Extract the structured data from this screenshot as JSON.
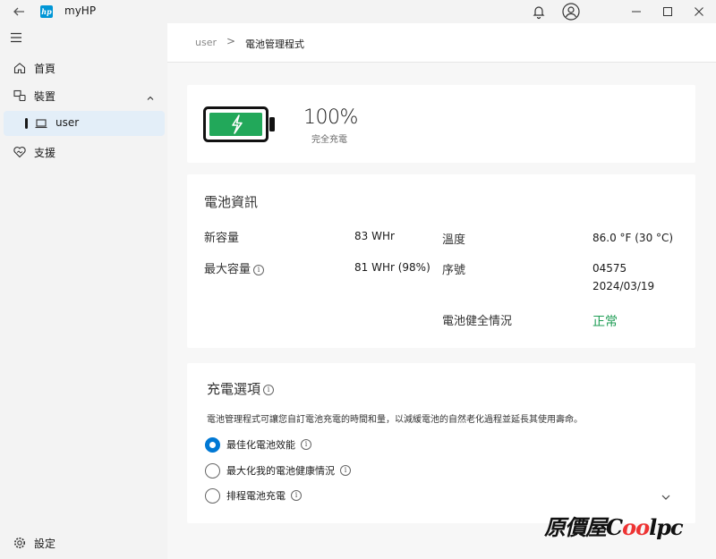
{
  "window": {
    "title": "myHP",
    "logo_text": "hp"
  },
  "sidebar": {
    "items": [
      {
        "label": "首頁",
        "icon": "home-icon"
      },
      {
        "label": "裝置",
        "icon": "devices-icon"
      },
      {
        "label": "user",
        "icon": "laptop-icon"
      },
      {
        "label": "支援",
        "icon": "support-icon"
      }
    ],
    "settings_label": "設定"
  },
  "breadcrumb": {
    "parent": "user",
    "separator": ">",
    "current": "電池管理程式"
  },
  "battery": {
    "percent": "100%",
    "status": "完全充電",
    "level": 1.0,
    "color": "#22a85a"
  },
  "info": {
    "title": "電池資訊",
    "new_capacity_label": "新容量",
    "new_capacity_value": "83 WHr",
    "max_capacity_label": "最大容量",
    "max_capacity_value": "81 WHr (98%)",
    "temp_label": "溫度",
    "temp_value": "86.0 °F (30 °C)",
    "serial_label": "序號",
    "serial_value": "04575",
    "serial_date": "2024/03/19",
    "health_label": "電池健全情況",
    "health_value": "正常",
    "info_mark": "i"
  },
  "charging": {
    "title": "充電選項",
    "description": "電池管理程式可讓您自訂電池充電的時間和量，以減緩電池的自然老化過程並延長其使用壽命。",
    "options": [
      {
        "label": "最佳化電池效能",
        "selected": true
      },
      {
        "label": "最大化我的電池健康情況",
        "selected": false
      },
      {
        "label": "排程電池充電",
        "selected": false
      }
    ]
  },
  "watermark": {
    "prefix": "原價屋",
    "c": "C",
    "loop": "oo",
    "suffix": "lpc"
  }
}
